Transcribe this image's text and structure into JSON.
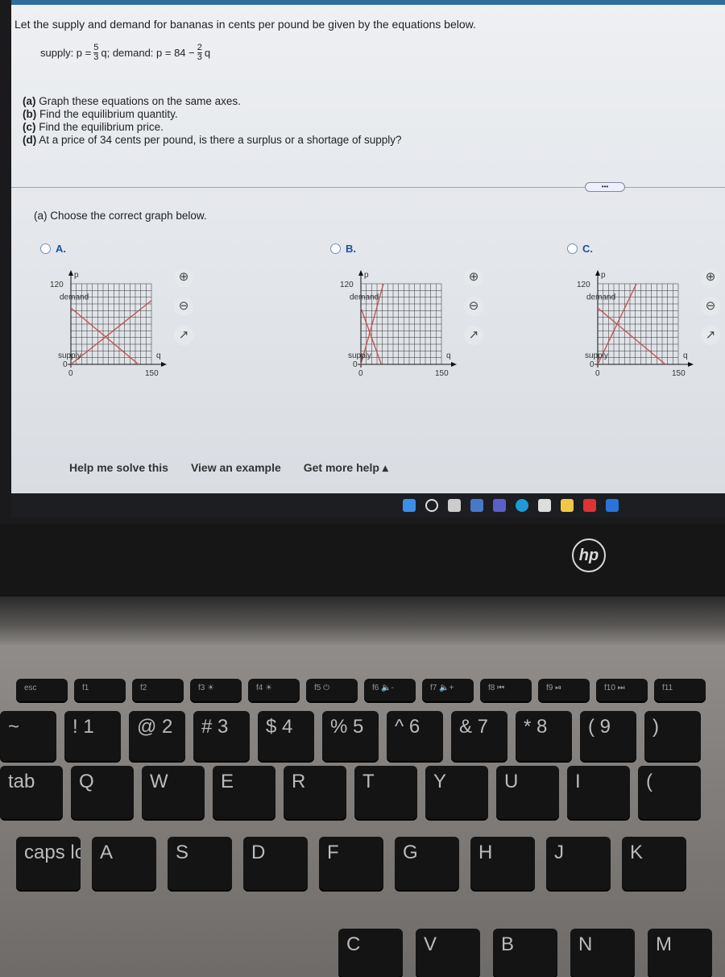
{
  "question": {
    "intro": "Let the supply and demand for bananas in cents per pound be given by the equations below.",
    "supply_prefix": "supply: p =",
    "supply_num": "5",
    "supply_den": "3",
    "supply_var": "q; demand: p = 84 −",
    "demand_num": "2",
    "demand_den": "3",
    "demand_var": "q",
    "parts": [
      {
        "tag": "(a)",
        "text": " Graph these equations on the same axes."
      },
      {
        "tag": "(b)",
        "text": " Find the equilibrium quantity."
      },
      {
        "tag": "(c)",
        "text": " Find the equilibrium price."
      },
      {
        "tag": "(d)",
        "text": " At a price of 34 cents per pound, is there a surplus or a shortage of supply?"
      }
    ],
    "more": "•••",
    "choose": "(a) Choose the correct graph below."
  },
  "line_color": "#c0504d",
  "options": [
    {
      "label": "A.",
      "y_axis": "p",
      "x_axis": "q",
      "y_max_label": "120",
      "zero": "0",
      "x_max_label": "150",
      "demand_label": "demand",
      "supply_label": "supply",
      "demand_line": [
        [
          0,
          84
        ],
        [
          126,
          0
        ]
      ],
      "supply_line": [
        [
          0,
          0
        ],
        [
          150,
          95
        ]
      ]
    },
    {
      "label": "B.",
      "y_axis": "p",
      "x_axis": "q",
      "y_max_label": "120",
      "zero": "0",
      "x_max_label": "150",
      "demand_label": "demand",
      "supply_label": "supply",
      "demand_line": [
        [
          0,
          84
        ],
        [
          38,
          0
        ]
      ],
      "supply_line": [
        [
          0,
          0
        ],
        [
          42,
          120
        ]
      ]
    },
    {
      "label": "C.",
      "y_axis": "p",
      "x_axis": "q",
      "y_max_label": "120",
      "zero": "0",
      "x_max_label": "150",
      "demand_label": "demand",
      "supply_label": "supply",
      "demand_line": [
        [
          0,
          84
        ],
        [
          126,
          0
        ]
      ],
      "supply_line": [
        [
          0,
          0
        ],
        [
          72,
          120
        ]
      ]
    }
  ],
  "tools": {
    "zoom_in": "⊕",
    "zoom_out": "⊖",
    "open": "↗"
  },
  "links": {
    "help": "Help me solve this",
    "example": "View an example",
    "more_help": "Get more help ▴"
  },
  "logo": "hp",
  "keys": {
    "fn": [
      "esc",
      "f1",
      "f2",
      "f3 ☀",
      "f4 ☀",
      "f5 ⏻",
      "f6 🔈-",
      "f7 🔈+",
      "f8 ⏮",
      "f9 ⏯",
      "f10 ⏭",
      "f11"
    ],
    "num": [
      "~",
      "! 1",
      "@ 2",
      "# 3",
      "$ 4",
      "% 5",
      "^ 6",
      "& 7",
      "* 8",
      "( 9",
      ")"
    ],
    "top": [
      "tab",
      "Q",
      "W",
      "E",
      "R",
      "T",
      "Y",
      "U",
      "I",
      "("
    ],
    "home": [
      "caps lock",
      "A",
      "S",
      "D",
      "F",
      "G",
      "H",
      "J",
      "K"
    ],
    "bottom": [
      "C",
      "V",
      "B",
      "N",
      "M"
    ]
  }
}
